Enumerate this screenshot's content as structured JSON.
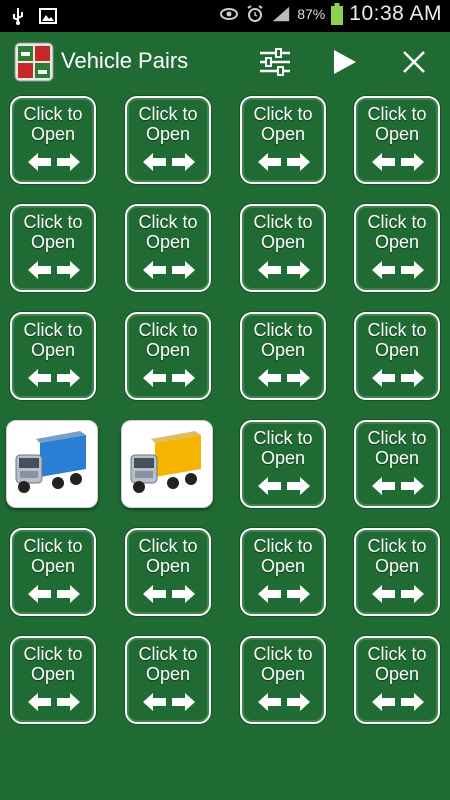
{
  "status_bar": {
    "battery_percent": "87%",
    "time": "10:38 AM"
  },
  "header": {
    "title": "Vehicle Pairs",
    "icons": [
      "app-logo",
      "settings-sliders-icon",
      "play-icon",
      "close-icon"
    ]
  },
  "card_label_line1": "Click to",
  "card_label_line2": "Open",
  "open_cards": [
    {
      "row": 4,
      "col": 1,
      "icon": "blue-truck-icon"
    },
    {
      "row": 4,
      "col": 2,
      "icon": "yellow-truck-icon"
    }
  ],
  "colors": {
    "background": "#1f6b33",
    "card_border": "#ffffff",
    "status_bar": "#000000"
  }
}
